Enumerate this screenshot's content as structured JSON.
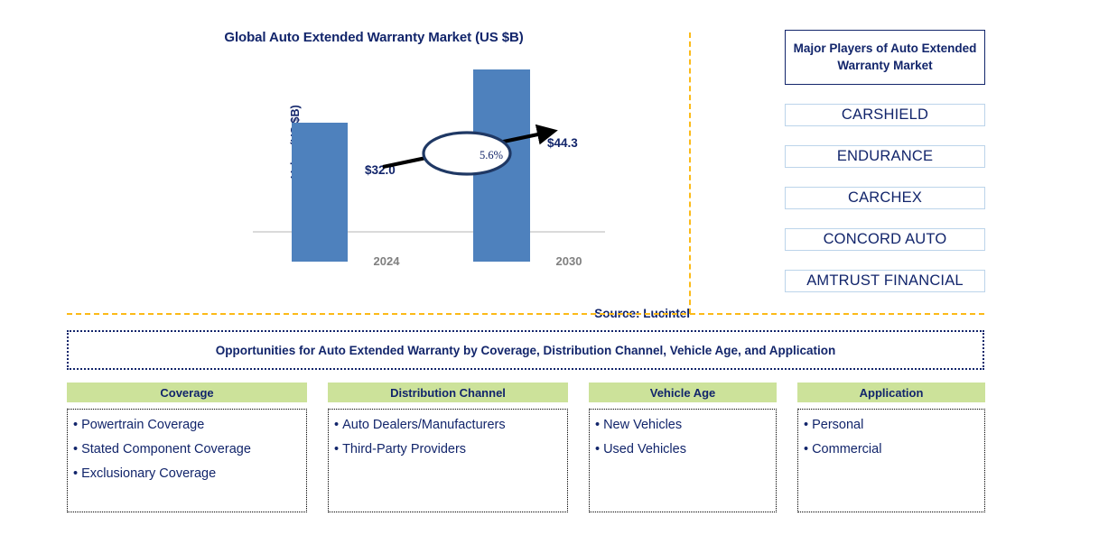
{
  "chart": {
    "title": "Global Auto Extended Warranty Market (US $B)",
    "ylabel": "Value (US $B)",
    "source": "Source: Lucintel",
    "cagr_label": "5.6%"
  },
  "chart_data": {
    "type": "bar",
    "title": "Global Auto Extended Warranty Market (US $B)",
    "xlabel": "",
    "ylabel": "Value (US $B)",
    "categories": [
      "2024",
      "2030"
    ],
    "values": [
      32.0,
      44.3
    ],
    "value_labels": [
      "$32.0",
      "$44.3"
    ],
    "ylim": [
      0,
      50
    ],
    "grid": false,
    "legend": "none",
    "bar_color": "#4e81bd",
    "annotations": [
      {
        "text": "5.6%",
        "type": "cagr-ellipse",
        "from": "2024",
        "to": "2030"
      }
    ]
  },
  "players": {
    "header": "Major Players of Auto Extended Warranty Market",
    "items": [
      "CARSHIELD",
      "ENDURANCE",
      "CARCHEX",
      "CONCORD AUTO",
      "AMTRUST FINANCIAL"
    ]
  },
  "opportunities": {
    "banner": "Opportunities for Auto Extended Warranty by Coverage, Distribution Channel, Vehicle Age, and Application",
    "columns": [
      {
        "header": "Coverage",
        "items": [
          "Powertrain Coverage",
          "Stated Component Coverage",
          "Exclusionary Coverage"
        ]
      },
      {
        "header": "Distribution Channel",
        "items": [
          "Auto Dealers/Manufacturers",
          "Third-Party Providers"
        ]
      },
      {
        "header": "Vehicle Age",
        "items": [
          "New Vehicles",
          "Used Vehicles"
        ]
      },
      {
        "header": "Application",
        "items": [
          "Personal",
          "Commercial"
        ]
      }
    ]
  },
  "colors": {
    "navy": "#12256b",
    "bar_blue": "#4e81bd",
    "accent_orange": "#fcba18",
    "header_green": "#cce29a"
  }
}
